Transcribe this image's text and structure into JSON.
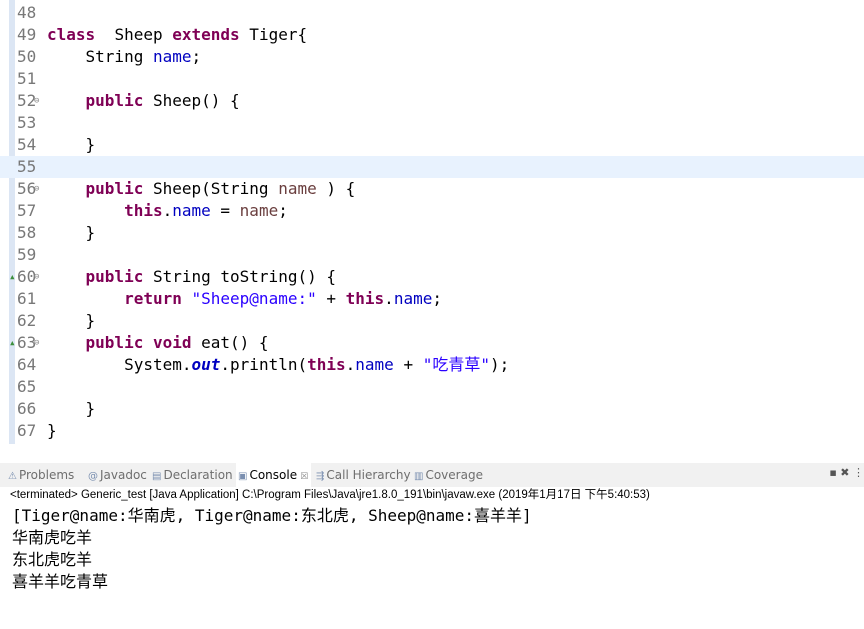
{
  "code_lines": [
    {
      "n": "48",
      "s": []
    },
    {
      "n": "49",
      "s": [
        [
          "kw",
          "class"
        ],
        [
          "",
          "  Sheep "
        ],
        [
          "kw",
          "extends"
        ],
        [
          "",
          " Tiger{"
        ]
      ]
    },
    {
      "n": "50",
      "s": [
        [
          "",
          "    String "
        ],
        [
          "fld",
          "name"
        ],
        [
          "",
          ";"
        ]
      ]
    },
    {
      "n": "51",
      "s": []
    },
    {
      "n": "52",
      "fold": true,
      "s": [
        [
          "",
          "    "
        ],
        [
          "kw",
          "public"
        ],
        [
          "",
          " Sheep() {"
        ]
      ]
    },
    {
      "n": "53",
      "s": []
    },
    {
      "n": "54",
      "s": [
        [
          "",
          "    }"
        ]
      ]
    },
    {
      "n": "55",
      "hl": true,
      "s": []
    },
    {
      "n": "56",
      "fold": true,
      "s": [
        [
          "",
          "    "
        ],
        [
          "kw",
          "public"
        ],
        [
          "",
          " Sheep(String "
        ],
        [
          "par",
          "name"
        ],
        [
          "",
          " ) {"
        ]
      ]
    },
    {
      "n": "57",
      "s": [
        [
          "",
          "        "
        ],
        [
          "kw",
          "this"
        ],
        [
          "",
          "."
        ],
        [
          "fld",
          "name"
        ],
        [
          "",
          " = "
        ],
        [
          "par",
          "name"
        ],
        [
          "",
          ";"
        ]
      ]
    },
    {
      "n": "58",
      "s": [
        [
          "",
          "    }"
        ]
      ]
    },
    {
      "n": "59",
      "s": []
    },
    {
      "n": "60",
      "fold": true,
      "override": true,
      "s": [
        [
          "",
          "    "
        ],
        [
          "kw",
          "public"
        ],
        [
          "",
          " String toString() {"
        ]
      ]
    },
    {
      "n": "61",
      "s": [
        [
          "",
          "        "
        ],
        [
          "kw",
          "return"
        ],
        [
          "",
          " "
        ],
        [
          "str",
          "\"Sheep@name:\""
        ],
        [
          "",
          " + "
        ],
        [
          "kw",
          "this"
        ],
        [
          "",
          "."
        ],
        [
          "fld",
          "name"
        ],
        [
          "",
          ";"
        ]
      ]
    },
    {
      "n": "62",
      "s": [
        [
          "",
          "    }"
        ]
      ]
    },
    {
      "n": "63",
      "fold": true,
      "override": true,
      "s": [
        [
          "",
          "    "
        ],
        [
          "kw",
          "public"
        ],
        [
          "",
          " "
        ],
        [
          "kw",
          "void"
        ],
        [
          "",
          " eat() {"
        ]
      ]
    },
    {
      "n": "64",
      "s": [
        [
          "",
          "        System."
        ],
        [
          "sfld",
          "out"
        ],
        [
          "",
          ".println("
        ],
        [
          "kw",
          "this"
        ],
        [
          "",
          "."
        ],
        [
          "fld",
          "name"
        ],
        [
          "",
          " + "
        ],
        [
          "str",
          "\"吃青草\""
        ],
        [
          "",
          ");"
        ]
      ]
    },
    {
      "n": "65",
      "s": []
    },
    {
      "n": "66",
      "s": [
        [
          "",
          "    }"
        ]
      ]
    },
    {
      "n": "67",
      "s": [
        [
          "",
          "}"
        ]
      ]
    }
  ],
  "tabs": [
    {
      "id": "problems",
      "label": "Problems",
      "icon": "problems-icon",
      "glyph": "⚠"
    },
    {
      "id": "javadoc",
      "label": "Javadoc",
      "icon": "javadoc-icon",
      "glyph": "@"
    },
    {
      "id": "declaration",
      "label": "Declaration",
      "icon": "declaration-icon",
      "glyph": "▤"
    },
    {
      "id": "console",
      "label": "Console",
      "icon": "console-icon",
      "glyph": "▣",
      "active": true,
      "close": "☒"
    },
    {
      "id": "call-hierarchy",
      "label": "Call Hierarchy",
      "icon": "call-hierarchy-icon",
      "glyph": "⇶"
    },
    {
      "id": "coverage",
      "label": "Coverage",
      "icon": "coverage-icon",
      "glyph": "▥"
    }
  ],
  "view_menu": "▪ ✖ ⋮",
  "console": {
    "status": "<terminated> Generic_test [Java Application] C:\\Program Files\\Java\\jre1.8.0_191\\bin\\javaw.exe (2019年1月17日 下午5:40:53)",
    "output": [
      "[Tiger@name:华南虎, Tiger@name:东北虎, Sheep@name:喜羊羊]",
      "华南虎吃羊",
      "东北虎吃羊",
      "喜羊羊吃青草"
    ]
  }
}
